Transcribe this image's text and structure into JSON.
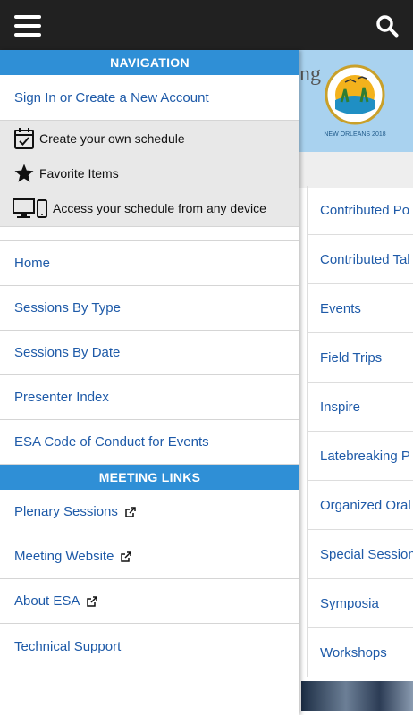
{
  "topbar": {
    "menu_icon": "hamburger-icon",
    "search_icon": "search-icon"
  },
  "background": {
    "title_fragment": "ng",
    "logo_text_top": "ecological society of america",
    "logo_text_bottom": "NEW ORLEANS 2018",
    "items": [
      "Contributed Po",
      "Contributed Tal",
      "Events",
      "Field Trips",
      "Inspire",
      "Latebreaking P",
      "Organized Oral",
      "Special Session",
      "Symposia",
      "Workshops"
    ]
  },
  "drawer": {
    "navigation_header": "NAVIGATION",
    "sign_in": "Sign In or Create a New Account",
    "features": [
      {
        "icon": "calendar-check-icon",
        "label": "Create your own schedule"
      },
      {
        "icon": "star-icon",
        "label": "Favorite Items"
      },
      {
        "icon": "devices-icon",
        "label": "Access your schedule from any device"
      }
    ],
    "nav_items": [
      "Home",
      "Sessions By Type",
      "Sessions By Date",
      "Presenter Index",
      "ESA Code of Conduct for Events"
    ],
    "meeting_links_header": "MEETING LINKS",
    "meeting_links": [
      {
        "label": "Plenary Sessions",
        "external": true
      },
      {
        "label": "Meeting Website",
        "external": true
      },
      {
        "label": "About ESA",
        "external": true
      },
      {
        "label": "Technical Support",
        "external": false
      }
    ]
  },
  "colors": {
    "topbar": "#212121",
    "accent": "#2f8fd6",
    "link": "#1e5aa8",
    "feature_bg": "#e8e8e8"
  }
}
